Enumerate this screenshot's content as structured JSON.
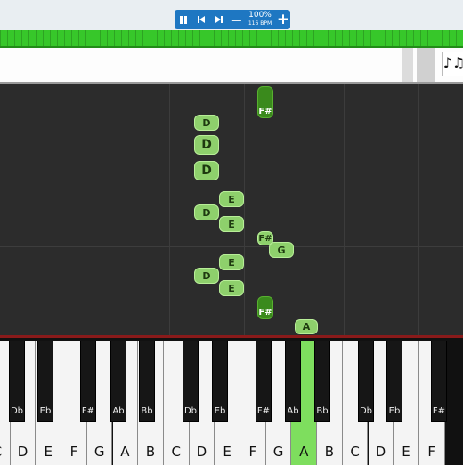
{
  "toolbar": {
    "pause_icon": "pause-icon",
    "prev_icon": "skip-back-icon",
    "next_icon": "skip-forward-icon",
    "minus_label": "−",
    "speed_percent": "100%",
    "bpm_label": "116 BPM",
    "plus_label": "+"
  },
  "sheet": {
    "icon": "sheet-music-icon",
    "glyph": "♪♫"
  },
  "colors": {
    "accent": "#1e77c2",
    "progress": "#37c72a",
    "note": "#8ed06c",
    "note_dark": "#3a8a1c"
  },
  "falling_notes": [
    {
      "label": "F#"
    },
    {
      "label": "D"
    },
    {
      "label": "D"
    },
    {
      "label": "D"
    },
    {
      "label": "E"
    },
    {
      "label": "D"
    },
    {
      "label": "E"
    },
    {
      "label": "F#"
    },
    {
      "label": "G"
    },
    {
      "label": "E"
    },
    {
      "label": "D"
    },
    {
      "label": "E"
    },
    {
      "label": "F#"
    },
    {
      "label": "A"
    }
  ],
  "white_keys": [
    "C",
    "D",
    "E",
    "F",
    "G",
    "A",
    "B",
    "C",
    "D",
    "E",
    "F",
    "G",
    "A",
    "B",
    "C",
    "D",
    "E",
    "F"
  ],
  "black_keys": [
    "Db",
    "Eb",
    "F#",
    "Ab",
    "Bb",
    "Db",
    "Eb",
    "F#",
    "Ab",
    "Bb",
    "Db",
    "Eb",
    "F#"
  ],
  "lit_key": "A"
}
